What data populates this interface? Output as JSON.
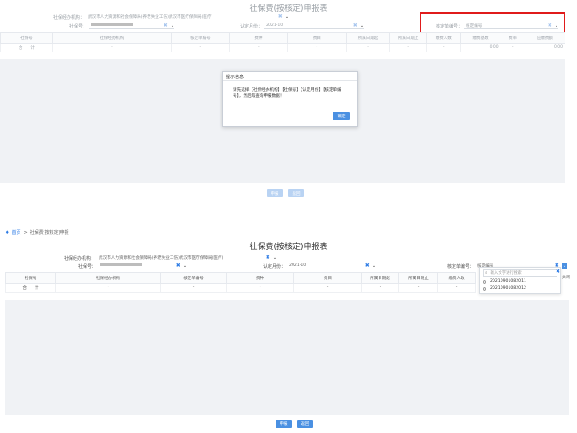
{
  "top": {
    "title": "社保费(按核定)申报表",
    "agency_label": "社保经办机构：",
    "agency_value": "武汉市人力资源和社会保障局(养老失业工伤)武汉市医疗保障局(医疗)",
    "socsec_label": "社保号：",
    "period_label": "认定月份：",
    "period_value": "2021-10",
    "approval_label": "核定单编号：",
    "approval_placeholder": "核定编号",
    "columns": [
      "社保号",
      "社保经办机构",
      "核定单编号",
      "费种",
      "费目",
      "所属日期起",
      "所属日期止",
      "缴费人数",
      "缴费基数",
      "费率",
      "应缴费额"
    ],
    "total_row": {
      "label": "合　　计",
      "dashes": [
        "-",
        "-",
        "-",
        "-",
        "-",
        "-",
        "-",
        "-"
      ],
      "base_total": "0.00",
      "rate": "-",
      "due_total": "0.00"
    },
    "buttons": {
      "declare": "申报",
      "back": "返回"
    },
    "dialog": {
      "title": "提示信息",
      "message": "请先选择【社保经办机构】【社保号】【认定月份】【核定单编号】，然后再查询申报数据！",
      "ok": "确定"
    }
  },
  "bottom": {
    "breadcrumb": {
      "home": "首页",
      "sep": ">",
      "current": "社保费(按核定)申报"
    },
    "title": "社保费(按核定)申报表",
    "agency_label": "社保经办机构：",
    "agency_value": "武汉市人力资源和社会保障局(养老失业工伤)武汉市医疗保障局(医疗)",
    "socsec_label": "社保号：",
    "period_label": "认定月份：",
    "period_value": "2021-10",
    "approval_label": "核定单编号：",
    "approval_placeholder": "核定编号",
    "columns": [
      "社保号",
      "社保经办机构",
      "核定单编号",
      "费种",
      "费目",
      "所属日期起",
      "所属日期止",
      "缴费人数"
    ],
    "total_row": {
      "label": "合　　计",
      "dashes": [
        "-",
        "-",
        "-",
        "-",
        "-",
        "-",
        "-"
      ]
    },
    "dropdown": {
      "search_placeholder": "输入文字进行搜索",
      "close_label": "关闭",
      "options": [
        "20210901082011",
        "20210901082012"
      ]
    },
    "buttons": {
      "declare": "申报",
      "back": "返回"
    }
  },
  "colors": {
    "accent": "#4a90e2",
    "highlight": "#e01b1b",
    "clear_icon": "#2c7be5"
  }
}
